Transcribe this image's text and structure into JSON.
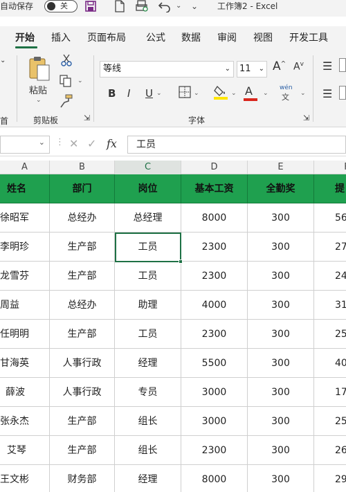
{
  "titlebar": {
    "autosave_label": "自动保存",
    "toggle_label": "关",
    "doc_title": "工作簿2 - Excel"
  },
  "tabs": [
    "开始",
    "插入",
    "页面布局",
    "公式",
    "数据",
    "审阅",
    "视图",
    "开发工具"
  ],
  "active_tab": "开始",
  "ribbon": {
    "paste_label": "粘贴",
    "clipboard_group": "剪贴板",
    "font_name": "等线",
    "font_size": "11",
    "font_group": "字体",
    "bold": "B",
    "italic": "I",
    "underline": "U",
    "font_color_letter": "A",
    "grow_font": "A",
    "shrink_font": "A",
    "phonetic_top": "wén",
    "phonetic_bottom": "文"
  },
  "formula_bar": {
    "cancel_icon": "✕",
    "enter_icon": "✓",
    "fx": "fx",
    "content": "工员"
  },
  "columns": [
    "A",
    "B",
    "C",
    "D",
    "E",
    "F"
  ],
  "selected_column": "C",
  "table": {
    "headers": [
      "姓名",
      "部门",
      "岗位",
      "基本工资",
      "全勤奖",
      "提"
    ],
    "rows": [
      [
        "徐昭军",
        "总经办",
        "总经理",
        "8000",
        "300",
        "56"
      ],
      [
        "李明珍",
        "生产部",
        "工员",
        "2300",
        "300",
        "27"
      ],
      [
        "龙雪芬",
        "生产部",
        "工员",
        "2300",
        "300",
        "24"
      ],
      [
        "周益",
        "总经办",
        "助理",
        "4000",
        "300",
        "31"
      ],
      [
        "任明明",
        "生产部",
        "工员",
        "2300",
        "300",
        "25"
      ],
      [
        "甘海英",
        "人事行政",
        "经理",
        "5500",
        "300",
        "40"
      ],
      [
        "薛波",
        "人事行政",
        "专员",
        "3000",
        "300",
        "17"
      ],
      [
        "张永杰",
        "生产部",
        "组长",
        "3000",
        "300",
        "25"
      ],
      [
        "艾琴",
        "生产部",
        "组长",
        "2300",
        "300",
        "26"
      ],
      [
        "王文彬",
        "财务部",
        "经理",
        "8000",
        "300",
        "29"
      ]
    ]
  },
  "colors": {
    "accent": "#1e7145",
    "header_fill": "#1fa04f"
  }
}
